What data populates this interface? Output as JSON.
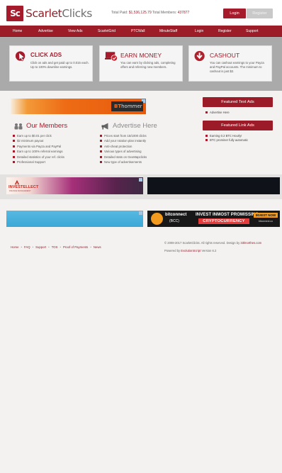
{
  "header": {
    "logo_mark": "Sc",
    "logo_text_a": "Scarlet",
    "logo_text_b": "Clicks",
    "total_paid_label": "Total Paid:",
    "total_paid_value": "$1,536,125.79",
    "total_members_label": "Total Members:",
    "total_members_value": "437877",
    "login_label": "Login",
    "register_label": "Register"
  },
  "nav": [
    "Home",
    "Advertise",
    "View Ads",
    "ScarletGrid",
    "PTCWall",
    "MinuteStaff",
    "Login",
    "Register",
    "Support"
  ],
  "cards": [
    {
      "title": "CLICK ADS",
      "icon": "cursor-icon",
      "desc": "Click on ads and get paid up to 0.015 each. Up to 100% downline earnings."
    },
    {
      "title": "EARN MONEY",
      "icon": "laptop-check-icon",
      "desc": "You can earn by clicking ads, completing offers and referring new members."
    },
    {
      "title": "CASHOUT",
      "icon": "download-icon",
      "desc": "You can cashout earnings to your Payza and PayPal accounts. The minimum to cashout is just $2."
    }
  ],
  "ads": {
    "bt_brand_a": "BT",
    "bt_brand_b": "hommer",
    "investellect": "INVESTELLECT",
    "investellect_sub": "FINANCE MANAGEMENT",
    "bitconnect_name": "bitconnect",
    "bitconnect_ticker": "(BCC)",
    "bitconnect_line1": "INVEST INMOST PROMISSING",
    "bitconnect_line2": "CRYPTOCURRENCY",
    "bitconnect_cta": "INVEST NOW",
    "bitconnect_url": "bitconnect.co"
  },
  "featured_text": {
    "title": "Featured Text Ads",
    "items": [
      "Advertise Here"
    ]
  },
  "featured_link": {
    "title": "Featured Link Ads",
    "items": [
      "Earning 0.2 BTC Hourly!",
      "BTC prominer fully automatic"
    ]
  },
  "members": {
    "title": "Our Members",
    "items": [
      "Earn up to $0.01 per click",
      "$2 minimum payout",
      "Payments via Payza and PayPal",
      "Earn up to 100% referral earnings",
      "Detailed statistics of your ref. clicks",
      "Professional Support"
    ]
  },
  "advertise": {
    "title": "Advertise Here",
    "items": [
      "Prices start from 15/1000 clicks",
      "Add your rotation plan instantly",
      "Anti-cheat protection",
      "Various types of advertising",
      "Detailed stats on GeoMapclicks",
      "New type of advertisements"
    ]
  },
  "footer": {
    "links": [
      "Home",
      "FAQ",
      "Support",
      "TOS",
      "Proof of Payments",
      "News"
    ],
    "copyright_a": "© 2008-2017 ScarletClicks. All rights reserved. Design by",
    "copyright_b": "33lmorthes.com",
    "powered_a": "Powered by",
    "powered_b": "EvolutionScript",
    "powered_c": "Version 6.2"
  },
  "colors": {
    "brand": "#a61b2b",
    "nav": "#9c1c28",
    "band": "#aaaaaa",
    "background": "#f4f2f1"
  }
}
